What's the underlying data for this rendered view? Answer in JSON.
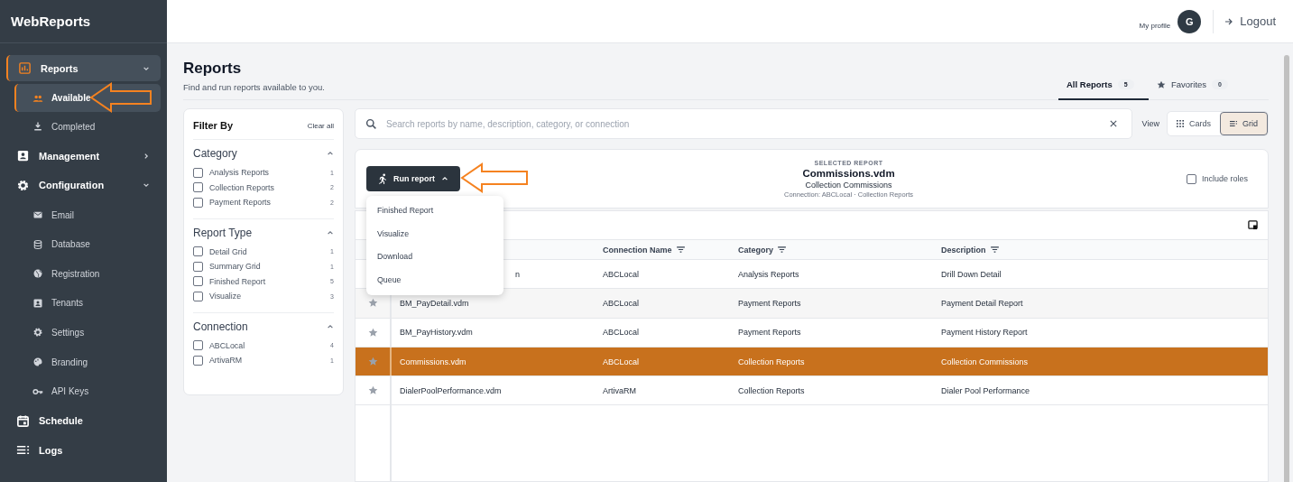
{
  "app": {
    "title": "WebReports"
  },
  "sidebar": {
    "items": [
      {
        "label": "Reports",
        "expanded": true,
        "selected": true,
        "children": [
          {
            "label": "Available",
            "selected": true
          },
          {
            "label": "Completed",
            "selected": false
          }
        ]
      },
      {
        "label": "Management",
        "expanded": false,
        "selected": false
      },
      {
        "label": "Configuration",
        "expanded": true,
        "selected": false,
        "children": [
          {
            "label": "Email",
            "selected": false
          },
          {
            "label": "Database",
            "selected": false
          },
          {
            "label": "Registration",
            "selected": false
          },
          {
            "label": "Tenants",
            "selected": false
          },
          {
            "label": "Settings",
            "selected": false
          },
          {
            "label": "Branding",
            "selected": false
          },
          {
            "label": "API Keys",
            "selected": false
          }
        ]
      },
      {
        "label": "Schedule",
        "selected": false
      },
      {
        "label": "Logs",
        "selected": false
      }
    ]
  },
  "header": {
    "profile_label": "My profile",
    "avatar": "G",
    "logout": "Logout"
  },
  "page": {
    "title": "Reports",
    "subtitle": "Find and run reports available to you."
  },
  "tabs": [
    {
      "label": "All Reports",
      "count": "5",
      "selected": true
    },
    {
      "label": "Favorites",
      "count": "0",
      "selected": false
    }
  ],
  "filters": {
    "title": "Filter By",
    "clear": "Clear all",
    "groups": [
      {
        "title": "Category",
        "expanded": true,
        "options": [
          {
            "label": "Analysis Reports",
            "count": "1",
            "checked": false
          },
          {
            "label": "Collection Reports",
            "count": "2",
            "checked": false
          },
          {
            "label": "Payment Reports",
            "count": "2",
            "checked": false
          }
        ]
      },
      {
        "title": "Report Type",
        "expanded": true,
        "options": [
          {
            "label": "Detail Grid",
            "count": "1",
            "checked": false
          },
          {
            "label": "Summary Grid",
            "count": "1",
            "checked": false
          },
          {
            "label": "Finished Report",
            "count": "5",
            "checked": false
          },
          {
            "label": "Visualize",
            "count": "3",
            "checked": false
          }
        ]
      },
      {
        "title": "Connection",
        "expanded": true,
        "options": [
          {
            "label": "ABCLocal",
            "count": "4",
            "checked": false
          },
          {
            "label": "ArtivaRM",
            "count": "1",
            "checked": false
          }
        ]
      }
    ]
  },
  "search": {
    "placeholder": "Search reports by name, description, category, or connection"
  },
  "view": {
    "label": "View",
    "options": [
      {
        "label": "Cards",
        "selected": false
      },
      {
        "label": "Grid",
        "selected": true
      }
    ]
  },
  "selected_report": {
    "caption": "SELECTED REPORT",
    "name": "Commissions.vdm",
    "description": "Collection Commissions",
    "meta": "Connection: ABCLocal · Collection Reports",
    "include_roles": {
      "label": "Include roles",
      "checked": false
    }
  },
  "run_menu": {
    "button": "Run report",
    "open": true,
    "items": [
      "Finished Report",
      "Visualize",
      "Download",
      "Queue"
    ]
  },
  "table": {
    "columns": [
      {
        "label": "Connection Name"
      },
      {
        "label": "Category"
      },
      {
        "label": "Description"
      }
    ],
    "rows": [
      {
        "selected": false,
        "name": "n",
        "name_cut": true,
        "connection": "ABCLocal",
        "category": "Analysis Reports",
        "description": "Drill Down Detail"
      },
      {
        "favorite": false,
        "selected": false,
        "name": "BM_PayDetail.vdm",
        "connection": "ABCLocal",
        "category": "Payment Reports",
        "description": "Payment Detail Report"
      },
      {
        "favorite": false,
        "selected": false,
        "name": "BM_PayHistory.vdm",
        "connection": "ABCLocal",
        "category": "Payment Reports",
        "description": "Payment History Report"
      },
      {
        "favorite": false,
        "selected": true,
        "name": "Commissions.vdm",
        "connection": "ABCLocal",
        "category": "Collection Reports",
        "description": "Collection Commissions"
      },
      {
        "favorite": false,
        "selected": false,
        "name": "DialerPoolPerformance.vdm",
        "connection": "ArtivaRM",
        "category": "Collection Reports",
        "description": "Dialer Pool Performance"
      }
    ]
  }
}
